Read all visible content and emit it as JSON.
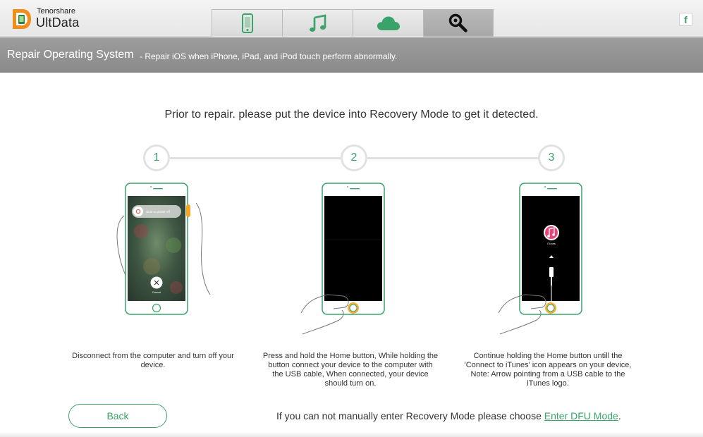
{
  "app": {
    "brand_small": "Tenorshare",
    "brand_big": "UltData"
  },
  "tabs": [
    {
      "icon": "phone-icon",
      "active": false
    },
    {
      "icon": "music-icon",
      "active": false
    },
    {
      "icon": "cloud-icon",
      "active": false
    },
    {
      "icon": "repair-tool-icon",
      "active": true
    }
  ],
  "social": {
    "facebook_glyph": "f"
  },
  "header": {
    "title": "Repair Operating System",
    "subtitle": "- Repair iOS when iPhone, iPad, and iPod touch perform abnormally."
  },
  "instruction": "Prior to repair. please put the device into Recovery Mode to get it detected.",
  "steps": [
    {
      "number": "1",
      "power_slider": "slide to power off",
      "cancel_label": "Cancel",
      "description": "Disconnect from the computer and turn off your device."
    },
    {
      "number": "2",
      "description": "Press and hold the Home button, While holding the button connect your device to the computer with the USB cable, When connected, your device should turn on."
    },
    {
      "number": "3",
      "itunes_label": "iTunes",
      "description": "Continue holding the Home button untill the 'Connect to iTunes' icon appears on your device, Note: Arrow pointing from a USB cable to the iTunes logo."
    }
  ],
  "footer": {
    "back_label": "Back",
    "dfu_text": "If you can not manually enter Recovery Mode please choose ",
    "dfu_link": "Enter DFU Mode",
    "dfu_suffix": "."
  },
  "colors": {
    "accent_green": "#3aa36a",
    "header_gray": "#959595",
    "orange_highlight": "#f5a623"
  }
}
